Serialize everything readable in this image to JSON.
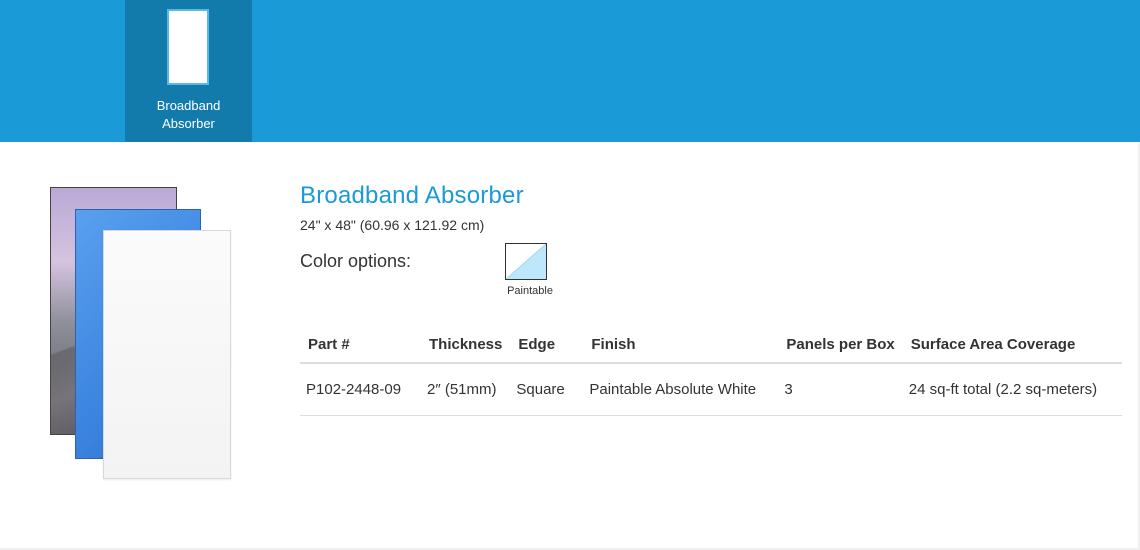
{
  "tabs": [
    {
      "label_line1": "Broadband",
      "label_line2": "Absorber",
      "active": true
    }
  ],
  "product": {
    "title": "Broadband Absorber",
    "dimensions": "24\" x 48\" (60.96 x 121.92 cm)",
    "color_options_label": "Color options:",
    "swatches": [
      {
        "label": "Paintable"
      }
    ]
  },
  "spec_table": {
    "headers": [
      "Part #",
      "Thickness",
      "Edge",
      "Finish",
      "Panels per Box",
      "Surface Area Coverage"
    ],
    "rows": [
      [
        "P102-2448-09",
        "2″ (51mm)",
        "Square",
        "Paintable Absolute White",
        "3",
        "24 sq-ft total (2.2 sq-meters)"
      ]
    ]
  },
  "colors": {
    "brand_blue": "#1a9ad6",
    "tab_active": "#127bac",
    "swatch_fill": "#bfe7fb"
  }
}
